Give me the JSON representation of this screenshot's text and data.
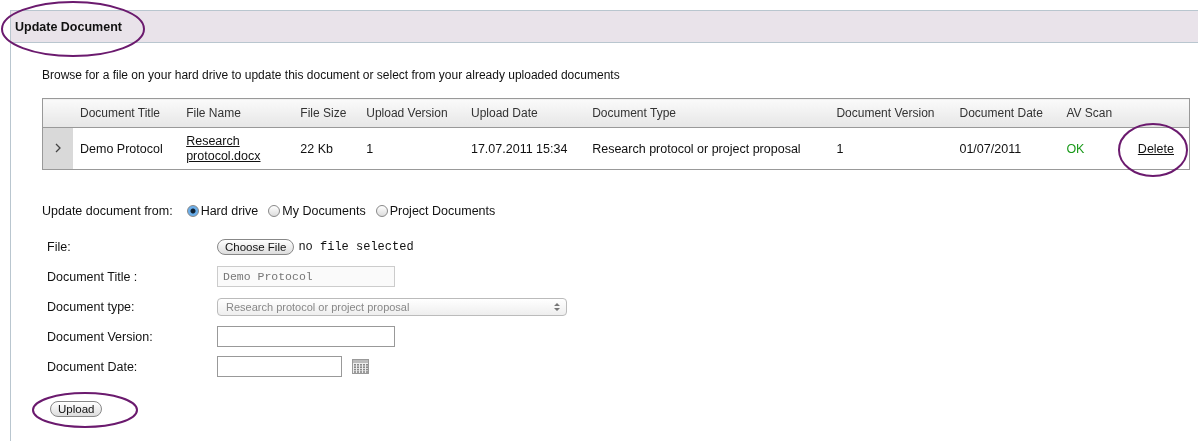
{
  "panel": {
    "title": "Update Document",
    "highlighted": true
  },
  "intro": "Browse for a file on your hard drive to update this document or select from your already uploaded documents",
  "table": {
    "columns": [
      "Document Title",
      "File Name",
      "File Size",
      "Upload Version",
      "Upload Date",
      "Document Type",
      "Document Version",
      "Document Date",
      "AV Scan"
    ],
    "rows": [
      {
        "expanded": false,
        "cells": [
          "Demo Protocol",
          "Research protocol.docx",
          "22 Kb",
          "1",
          "17.07.2011 15:34",
          "Research protocol or project proposal",
          "1",
          "01/07/2011",
          "OK"
        ],
        "action": "Delete",
        "action_highlighted": true
      }
    ]
  },
  "source": {
    "label": "Update document from:",
    "options": [
      {
        "label": "Hard drive",
        "selected": true
      },
      {
        "label": "My Documents",
        "selected": false
      },
      {
        "label": "Project Documents",
        "selected": false
      }
    ]
  },
  "form": [
    {
      "kind": "file",
      "label": "File:",
      "button": "Choose File",
      "value": "no file selected"
    },
    {
      "kind": "text",
      "label": "Document Title :",
      "value": "Demo Protocol",
      "disabled": true
    },
    {
      "kind": "select",
      "label": "Document type:",
      "value": "Research protocol or project proposal",
      "disabled": true
    },
    {
      "kind": "text",
      "label": "Document Version:",
      "disabled": false
    },
    {
      "kind": "date",
      "label": "Document Date:"
    }
  ],
  "submit": {
    "label": "Upload",
    "highlighted": true
  }
}
